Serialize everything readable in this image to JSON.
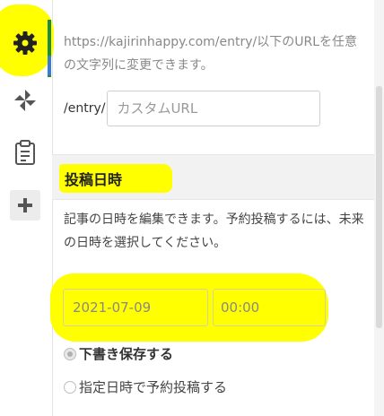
{
  "sidebar": {
    "items": [
      {
        "icon": "gear-icon",
        "active": true
      },
      {
        "icon": "pinwheel-icon"
      },
      {
        "icon": "clipboard-icon"
      },
      {
        "icon": "plus-icon"
      }
    ],
    "active_color": "#1f8a43"
  },
  "permalink": {
    "note": "https://kajirinhappy.com/entry/以下のURLを任意の文字列に変更できます。",
    "prefix": "/entry/",
    "placeholder": "カスタムURL"
  },
  "schedule": {
    "title": "投稿日時",
    "description": "記事の日時を編集できます。予約投稿するには、未来の日時を選択してください。",
    "date_value": "2021-07-09",
    "time_value": "00:00",
    "options": [
      {
        "label": "下書き保存する",
        "selected": true
      },
      {
        "label": "指定日時で予約投稿する",
        "selected": false
      }
    ]
  },
  "highlight_color": "#ffff00"
}
